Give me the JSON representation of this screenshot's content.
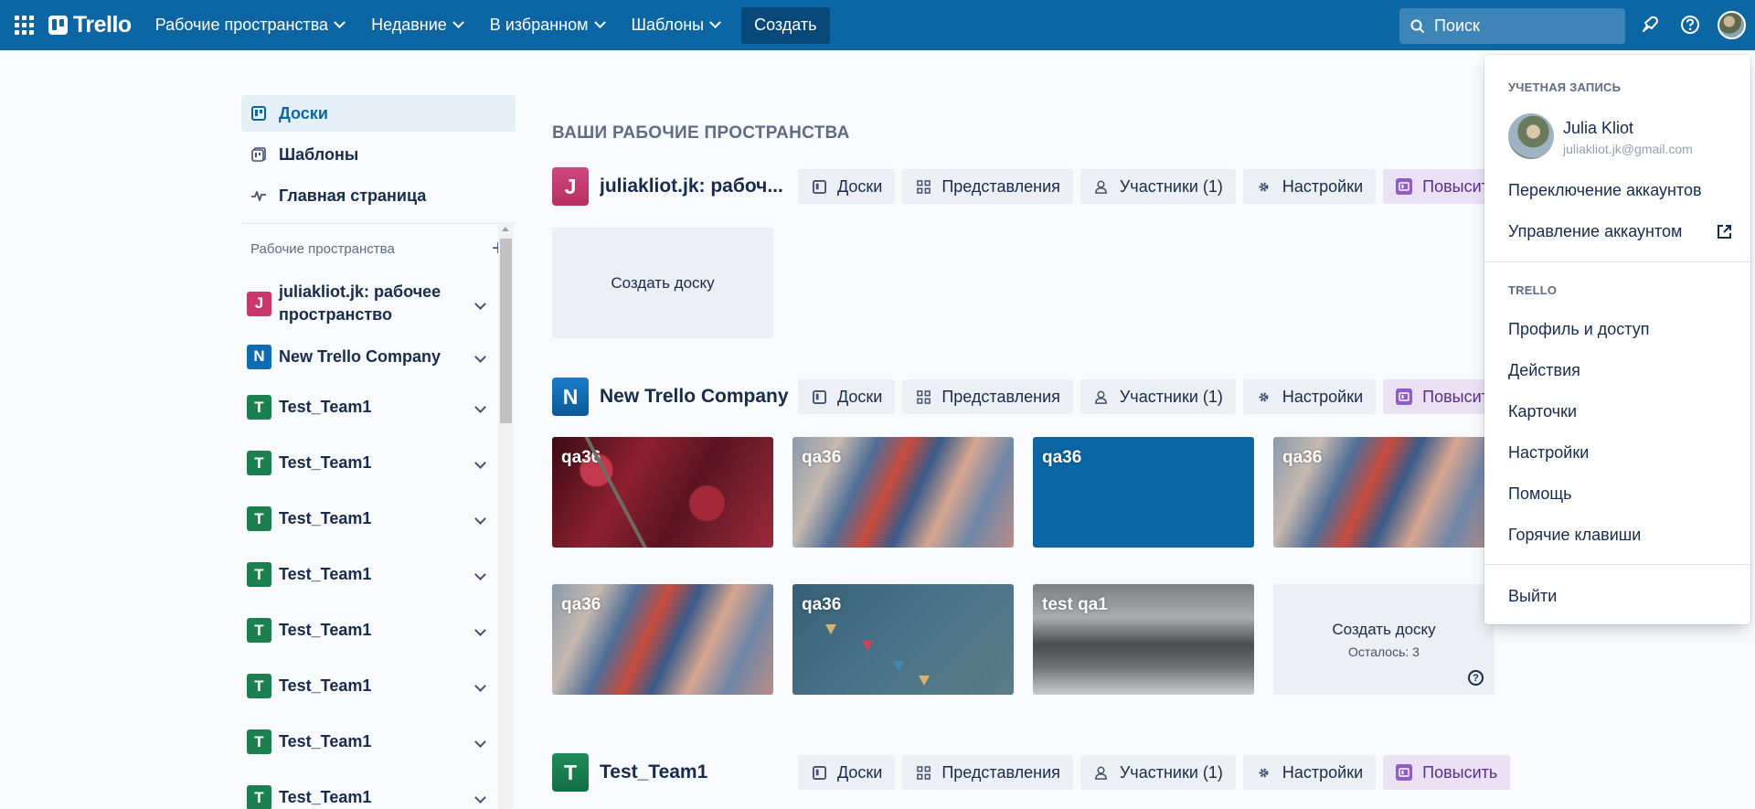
{
  "topbar": {
    "logo_text": "Trello",
    "menus": [
      {
        "label": "Рабочие пространства"
      },
      {
        "label": "Недавние"
      },
      {
        "label": "В избранном"
      },
      {
        "label": "Шаблоны"
      }
    ],
    "create_label": "Создать",
    "search_placeholder": "Поиск",
    "accent": "#0c66a4"
  },
  "sidebar": {
    "nav": [
      {
        "label": "Доски",
        "icon": "board-icon",
        "active": true
      },
      {
        "label": "Шаблоны",
        "icon": "template-icon",
        "active": false
      },
      {
        "label": "Главная страница",
        "icon": "activity-icon",
        "active": false
      }
    ],
    "workspaces_header": "Рабочие пространства",
    "workspaces": [
      {
        "letter": "J",
        "name": "juliakliot.jk: рабочее пространство",
        "color": "#c9376b"
      },
      {
        "letter": "N",
        "name": "New Trello Company",
        "color": "#0f6bb3"
      },
      {
        "letter": "T",
        "name": "Test_Team1",
        "color": "#1b7f4f"
      },
      {
        "letter": "T",
        "name": "Test_Team1",
        "color": "#1b7f4f"
      },
      {
        "letter": "T",
        "name": "Test_Team1",
        "color": "#1b7f4f"
      },
      {
        "letter": "T",
        "name": "Test_Team1",
        "color": "#1b7f4f"
      },
      {
        "letter": "T",
        "name": "Test_Team1",
        "color": "#1b7f4f"
      },
      {
        "letter": "T",
        "name": "Test_Team1",
        "color": "#1b7f4f"
      },
      {
        "letter": "T",
        "name": "Test_Team1",
        "color": "#1b7f4f"
      },
      {
        "letter": "T",
        "name": "Test_Team1",
        "color": "#1b7f4f"
      }
    ]
  },
  "main": {
    "section_title": "ВАШИ РАБОЧИЕ ПРОСТРАНСТВА",
    "buttons": {
      "boards": "Доски",
      "views": "Представления",
      "members": "Участники (1)",
      "settings": "Настройки",
      "upgrade": "Повысить"
    },
    "workspaces": [
      {
        "letter": "J",
        "name": "juliakliot.jk: рабоч...",
        "color": "#c9376b"
      },
      {
        "letter": "N",
        "name": "New Trello Company",
        "color": "#0f6bb3"
      },
      {
        "letter": "T",
        "name": "Test_Team1",
        "color": "#1b7f4f"
      }
    ],
    "create_board_label": "Создать доску",
    "remaining_label": "Осталось: 3",
    "boards": [
      {
        "name": "qa36",
        "bg": "forest"
      },
      {
        "name": "qa36",
        "bg": "abstract"
      },
      {
        "name": "qa36",
        "bg": "blue"
      },
      {
        "name": "qa36",
        "bg": "abstract"
      },
      {
        "name": "qa36",
        "bg": "abstract"
      },
      {
        "name": "qa36",
        "bg": "teal"
      },
      {
        "name": "test qa1",
        "bg": "winter"
      }
    ]
  },
  "dropdown": {
    "account_section": "УЧЕТНАЯ ЗАПИСЬ",
    "user_name": "Julia Kliot",
    "user_email": "juliakliot.jk@gmail.com",
    "switch_accounts": "Переключение аккаунтов",
    "manage_account": "Управление аккаунтом",
    "trello_section": "TRELLO",
    "trello_items": [
      "Профиль и доступ",
      "Действия",
      "Карточки",
      "Настройки",
      "Помощь",
      "Горячие клавиши"
    ],
    "logout": "Выйти"
  }
}
